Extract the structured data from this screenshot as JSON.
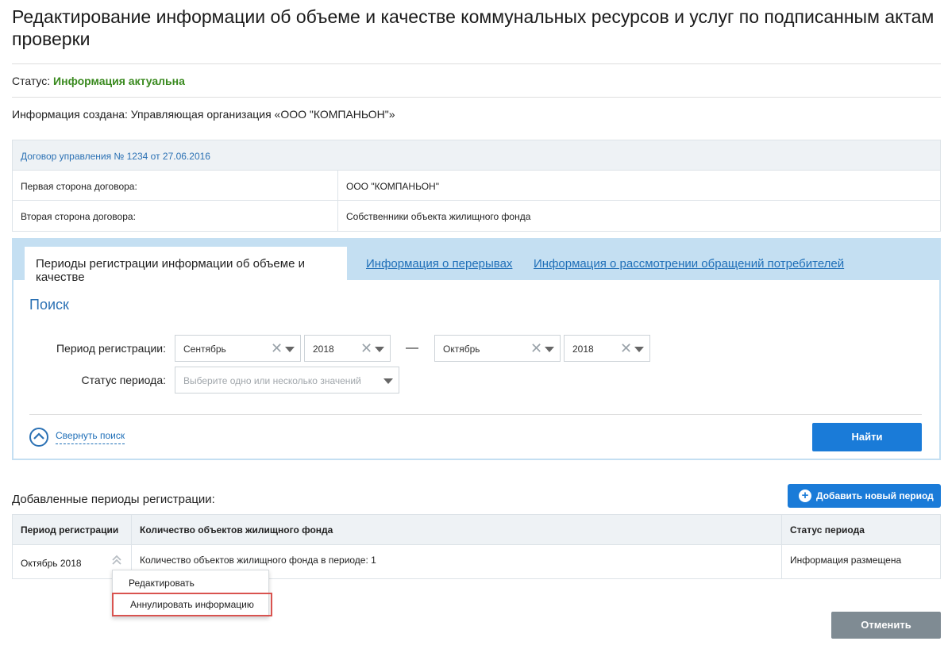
{
  "page": {
    "title": "Редактирование информации об объеме и качестве коммунальных ресурсов и услуг по подписанным актам проверки"
  },
  "status": {
    "label": "Статус:",
    "value": "Информация актуальна",
    "value_color": "#3a8a1f"
  },
  "created": {
    "text": "Информация создана: Управляющая организация «ООО \"КОМПАНЬОН\"»"
  },
  "contract": {
    "header": "Договор управления № 1234 от 27.06.2016",
    "rows": [
      {
        "key": "Первая сторона договора:",
        "value": "ООО \"КОМПАНЬОН\""
      },
      {
        "key": "Вторая сторона договора:",
        "value": "Собственники объекта жилищного фонда"
      }
    ]
  },
  "tabs": [
    {
      "label": "Периоды регистрации информации об объеме и качестве",
      "active": true
    },
    {
      "label": "Информация о перерывах",
      "active": false
    },
    {
      "label": "Информация о рассмотрении обращений потребителей",
      "active": false
    }
  ],
  "search": {
    "title": "Поиск",
    "period_label": "Период регистрации:",
    "from_month": "Сентябрь",
    "from_year": "2018",
    "separator": "—",
    "to_month": "Октябрь",
    "to_year": "2018",
    "status_label": "Статус периода:",
    "status_placeholder": "Выберите одно или несколько значений",
    "collapse_label": "Свернуть поиск",
    "find_button": "Найти"
  },
  "periods": {
    "title": "Добавленные периоды регистрации:",
    "add_button": "Добавить новый период",
    "columns": [
      "Период регистрации",
      "Количество объектов жилищного фонда",
      "Статус периода"
    ],
    "rows": [
      {
        "period": "Октябрь 2018",
        "count_text": "Количество объектов жилищного фонда в периоде: 1",
        "status": "Информация размещена"
      }
    ]
  },
  "context_menu": {
    "items": [
      "Редактировать",
      "Аннулировать информацию"
    ],
    "highlight_color": "#d9534f"
  },
  "footer": {
    "cancel_button": "Отменить"
  },
  "colors": {
    "accent": "#1a7bd8",
    "link": "#1f6fb8",
    "tab_bar": "#c4dff2",
    "cancel": "#7f8b93"
  }
}
